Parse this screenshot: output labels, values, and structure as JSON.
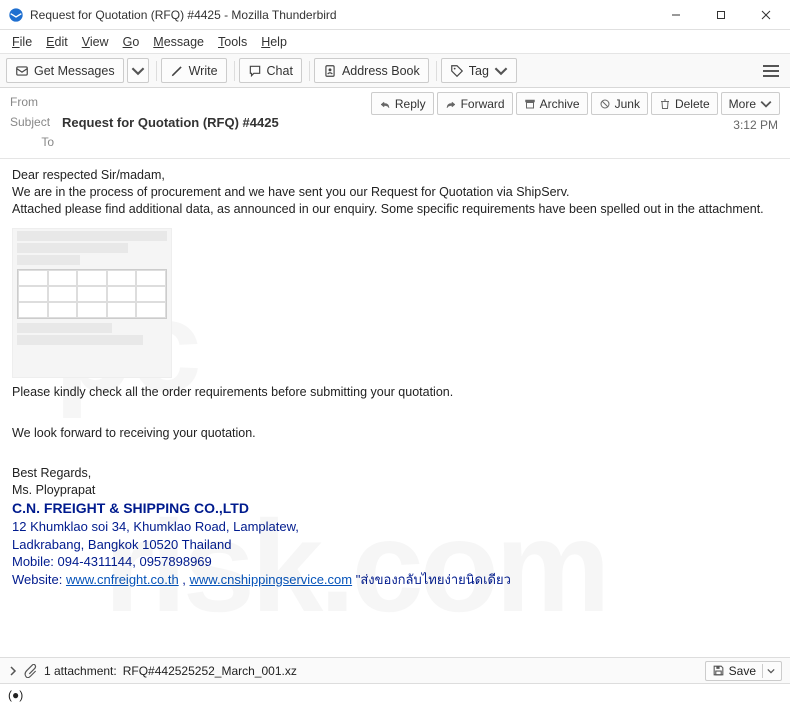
{
  "window": {
    "title": "Request for Quotation (RFQ) #4425 - Mozilla Thunderbird"
  },
  "menu": {
    "file": "File",
    "edit": "Edit",
    "view": "View",
    "go": "Go",
    "message": "Message",
    "tools": "Tools",
    "help": "Help"
  },
  "toolbar": {
    "get_messages": "Get Messages",
    "write": "Write",
    "chat": "Chat",
    "address_book": "Address Book",
    "tag": "Tag"
  },
  "actions": {
    "reply": "Reply",
    "forward": "Forward",
    "archive": "Archive",
    "junk": "Junk",
    "delete": "Delete",
    "more": "More"
  },
  "header": {
    "from_label": "From",
    "subject_label": "Subject",
    "subject_value": "Request for Quotation (RFQ) #4425",
    "to_label": "To",
    "time": "3:12 PM"
  },
  "bodytext": {
    "l1": "Dear respected Sir/madam,",
    "l2": "We are in the process of procurement and we have sent you our Request for Quotation via ShipServ.",
    "l3": "Attached please find additional data, as announced in our enquiry. Some specific requirements have been spelled out in the attachment.",
    "l4": "Please kindly check all the order requirements before submitting your quotation.",
    "l5": "We look forward to receiving your quotation.",
    "l6": "Best Regards,",
    "l7": "Ms. Ployprapat"
  },
  "signature": {
    "company": "C.N. FREIGHT & SHIPPING CO.,LTD",
    "addr1": "12 Khumklao soi 34, Khumklao Road, Lamplatew,",
    "addr2": "Ladkrabang, Bangkok 10520 Thailand",
    "mobile_label": "Mobile:",
    "mobile_value": "094-4311144, 0957898969",
    "website_label": "Website:",
    "url1": "www.cnfreight.co.th",
    "sep": " , ",
    "url2": "www.cnshippingservice.com",
    "tag": " \"ส่งของกลับไทยง่ายนิดเดียว"
  },
  "attachment": {
    "count_label": "1 attachment:",
    "filename": "RFQ#442525252_March_001.xz",
    "save": "Save"
  },
  "watermark": {
    "a": "pc",
    "b": "risk.com"
  }
}
